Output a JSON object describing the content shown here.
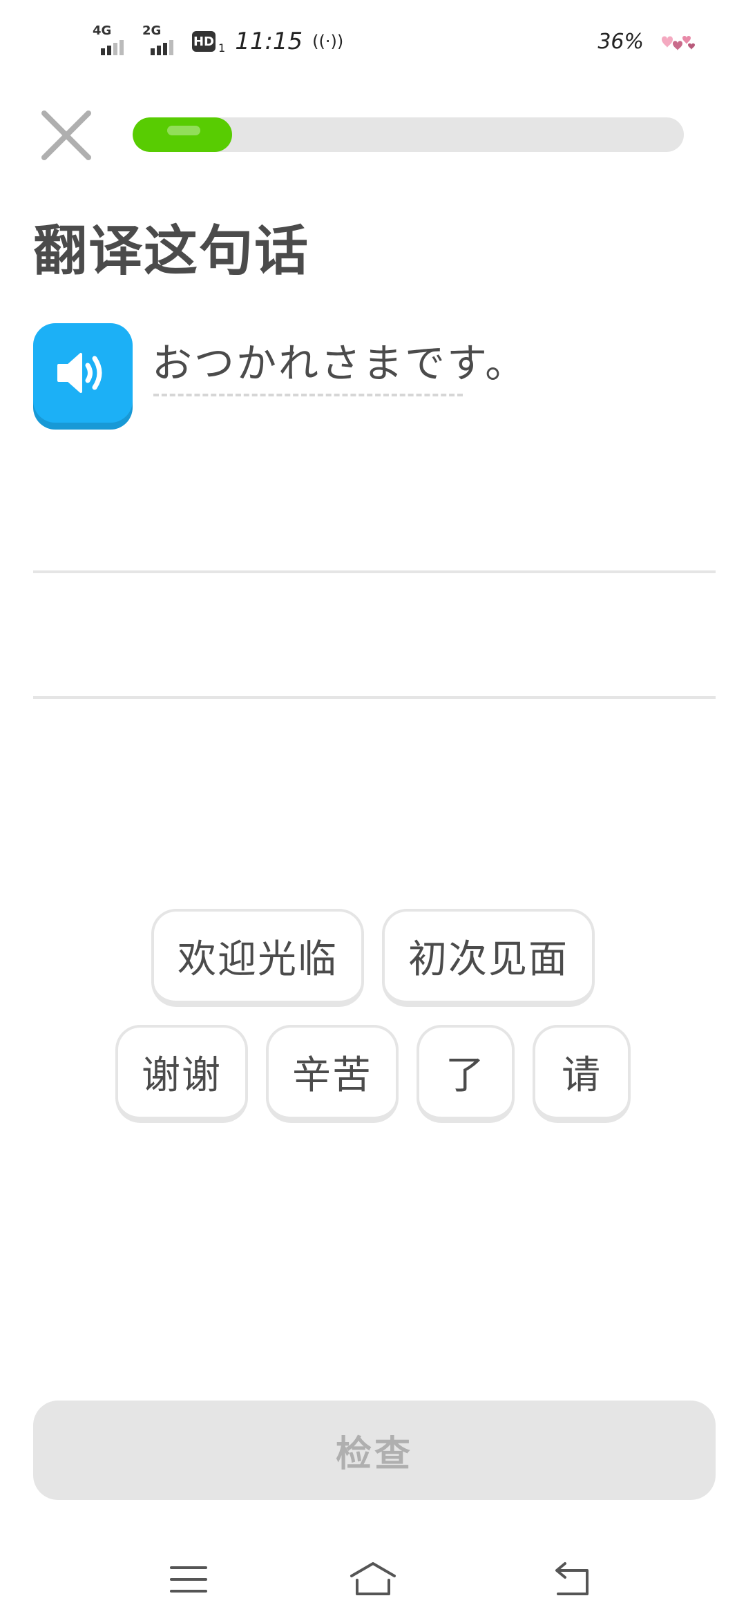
{
  "status_bar": {
    "network1": "4G",
    "network2": "2G",
    "hd_badge": "HD",
    "hd_sub": "1",
    "time": "11:15",
    "battery": "36%",
    "icons": [
      "signal-icon",
      "hd-icon",
      "hotspot-icon",
      "hearts-icon"
    ]
  },
  "header": {
    "progress_percent": 18,
    "progress_color": "#58cc02",
    "close_icon": "close-icon"
  },
  "exercise": {
    "title": "翻译这句话",
    "prompt": "おつかれさまです。",
    "speaker_color": "#1cb0f6"
  },
  "word_bank": {
    "row1": [
      "欢迎光临",
      "初次见面"
    ],
    "row2": [
      "谢谢",
      "辛苦",
      "了",
      "请"
    ]
  },
  "check_button": {
    "label": "检查"
  },
  "nav_bar": {
    "icons": [
      "menu-icon",
      "home-icon",
      "back-icon"
    ]
  }
}
